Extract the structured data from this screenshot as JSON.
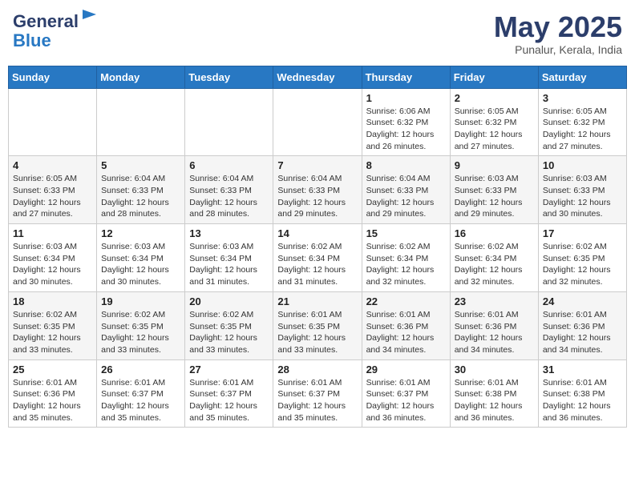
{
  "header": {
    "logo_general": "General",
    "logo_blue": "Blue",
    "month_year": "May 2025",
    "location": "Punalur, Kerala, India"
  },
  "weekdays": [
    "Sunday",
    "Monday",
    "Tuesday",
    "Wednesday",
    "Thursday",
    "Friday",
    "Saturday"
  ],
  "weeks": [
    [
      {
        "day": "",
        "info": ""
      },
      {
        "day": "",
        "info": ""
      },
      {
        "day": "",
        "info": ""
      },
      {
        "day": "",
        "info": ""
      },
      {
        "day": "1",
        "info": "Sunrise: 6:06 AM\nSunset: 6:32 PM\nDaylight: 12 hours\nand 26 minutes."
      },
      {
        "day": "2",
        "info": "Sunrise: 6:05 AM\nSunset: 6:32 PM\nDaylight: 12 hours\nand 27 minutes."
      },
      {
        "day": "3",
        "info": "Sunrise: 6:05 AM\nSunset: 6:32 PM\nDaylight: 12 hours\nand 27 minutes."
      }
    ],
    [
      {
        "day": "4",
        "info": "Sunrise: 6:05 AM\nSunset: 6:33 PM\nDaylight: 12 hours\nand 27 minutes."
      },
      {
        "day": "5",
        "info": "Sunrise: 6:04 AM\nSunset: 6:33 PM\nDaylight: 12 hours\nand 28 minutes."
      },
      {
        "day": "6",
        "info": "Sunrise: 6:04 AM\nSunset: 6:33 PM\nDaylight: 12 hours\nand 28 minutes."
      },
      {
        "day": "7",
        "info": "Sunrise: 6:04 AM\nSunset: 6:33 PM\nDaylight: 12 hours\nand 29 minutes."
      },
      {
        "day": "8",
        "info": "Sunrise: 6:04 AM\nSunset: 6:33 PM\nDaylight: 12 hours\nand 29 minutes."
      },
      {
        "day": "9",
        "info": "Sunrise: 6:03 AM\nSunset: 6:33 PM\nDaylight: 12 hours\nand 29 minutes."
      },
      {
        "day": "10",
        "info": "Sunrise: 6:03 AM\nSunset: 6:33 PM\nDaylight: 12 hours\nand 30 minutes."
      }
    ],
    [
      {
        "day": "11",
        "info": "Sunrise: 6:03 AM\nSunset: 6:34 PM\nDaylight: 12 hours\nand 30 minutes."
      },
      {
        "day": "12",
        "info": "Sunrise: 6:03 AM\nSunset: 6:34 PM\nDaylight: 12 hours\nand 30 minutes."
      },
      {
        "day": "13",
        "info": "Sunrise: 6:03 AM\nSunset: 6:34 PM\nDaylight: 12 hours\nand 31 minutes."
      },
      {
        "day": "14",
        "info": "Sunrise: 6:02 AM\nSunset: 6:34 PM\nDaylight: 12 hours\nand 31 minutes."
      },
      {
        "day": "15",
        "info": "Sunrise: 6:02 AM\nSunset: 6:34 PM\nDaylight: 12 hours\nand 32 minutes."
      },
      {
        "day": "16",
        "info": "Sunrise: 6:02 AM\nSunset: 6:34 PM\nDaylight: 12 hours\nand 32 minutes."
      },
      {
        "day": "17",
        "info": "Sunrise: 6:02 AM\nSunset: 6:35 PM\nDaylight: 12 hours\nand 32 minutes."
      }
    ],
    [
      {
        "day": "18",
        "info": "Sunrise: 6:02 AM\nSunset: 6:35 PM\nDaylight: 12 hours\nand 33 minutes."
      },
      {
        "day": "19",
        "info": "Sunrise: 6:02 AM\nSunset: 6:35 PM\nDaylight: 12 hours\nand 33 minutes."
      },
      {
        "day": "20",
        "info": "Sunrise: 6:02 AM\nSunset: 6:35 PM\nDaylight: 12 hours\nand 33 minutes."
      },
      {
        "day": "21",
        "info": "Sunrise: 6:01 AM\nSunset: 6:35 PM\nDaylight: 12 hours\nand 33 minutes."
      },
      {
        "day": "22",
        "info": "Sunrise: 6:01 AM\nSunset: 6:36 PM\nDaylight: 12 hours\nand 34 minutes."
      },
      {
        "day": "23",
        "info": "Sunrise: 6:01 AM\nSunset: 6:36 PM\nDaylight: 12 hours\nand 34 minutes."
      },
      {
        "day": "24",
        "info": "Sunrise: 6:01 AM\nSunset: 6:36 PM\nDaylight: 12 hours\nand 34 minutes."
      }
    ],
    [
      {
        "day": "25",
        "info": "Sunrise: 6:01 AM\nSunset: 6:36 PM\nDaylight: 12 hours\nand 35 minutes."
      },
      {
        "day": "26",
        "info": "Sunrise: 6:01 AM\nSunset: 6:37 PM\nDaylight: 12 hours\nand 35 minutes."
      },
      {
        "day": "27",
        "info": "Sunrise: 6:01 AM\nSunset: 6:37 PM\nDaylight: 12 hours\nand 35 minutes."
      },
      {
        "day": "28",
        "info": "Sunrise: 6:01 AM\nSunset: 6:37 PM\nDaylight: 12 hours\nand 35 minutes."
      },
      {
        "day": "29",
        "info": "Sunrise: 6:01 AM\nSunset: 6:37 PM\nDaylight: 12 hours\nand 36 minutes."
      },
      {
        "day": "30",
        "info": "Sunrise: 6:01 AM\nSunset: 6:38 PM\nDaylight: 12 hours\nand 36 minutes."
      },
      {
        "day": "31",
        "info": "Sunrise: 6:01 AM\nSunset: 6:38 PM\nDaylight: 12 hours\nand 36 minutes."
      }
    ]
  ]
}
